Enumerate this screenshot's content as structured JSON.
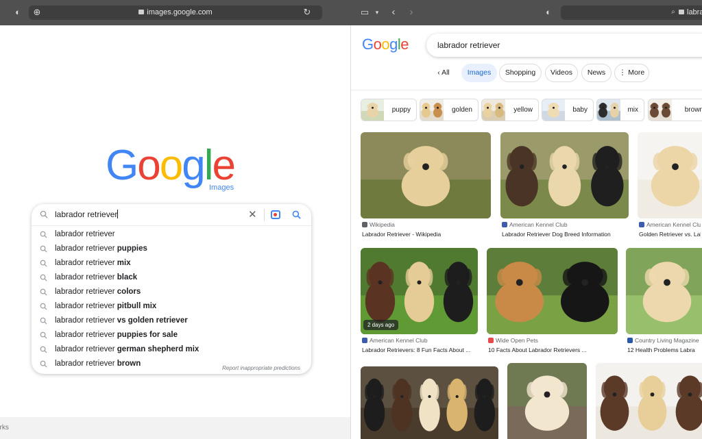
{
  "left_browser": {
    "url": "images.google.com"
  },
  "right_browser": {
    "url": "labrac"
  },
  "left_page": {
    "logo_letters": [
      {
        "ch": "G",
        "color": "#4285f4"
      },
      {
        "ch": "o",
        "color": "#ea4335"
      },
      {
        "ch": "o",
        "color": "#fbbc05"
      },
      {
        "ch": "g",
        "color": "#4285f4"
      },
      {
        "ch": "l",
        "color": "#34a853"
      },
      {
        "ch": "e",
        "color": "#ea4335"
      }
    ],
    "logo_sub": "Images",
    "search_query": "labrador retriever",
    "suggestions": [
      {
        "base": "labrador retriever",
        "bold": ""
      },
      {
        "base": "labrador retriever",
        "bold": "puppies"
      },
      {
        "base": "labrador retriever",
        "bold": "mix"
      },
      {
        "base": "labrador retriever",
        "bold": "black"
      },
      {
        "base": "labrador retriever",
        "bold": "colors"
      },
      {
        "base": "labrador retriever",
        "bold": "pitbull mix"
      },
      {
        "base": "labrador retriever",
        "bold": "vs golden retriever"
      },
      {
        "base": "labrador retriever",
        "bold": "puppies for sale"
      },
      {
        "base": "labrador retriever",
        "bold": "german shepherd mix"
      },
      {
        "base": "labrador retriever",
        "bold": "brown"
      }
    ],
    "report_link": "Report inappropriate predictions",
    "footer_text": "orks"
  },
  "right_page": {
    "logo_letters": [
      {
        "ch": "G",
        "color": "#4285f4"
      },
      {
        "ch": "o",
        "color": "#ea4335"
      },
      {
        "ch": "o",
        "color": "#fbbc05"
      },
      {
        "ch": "g",
        "color": "#4285f4"
      },
      {
        "ch": "l",
        "color": "#34a853"
      },
      {
        "ch": "e",
        "color": "#ea4335"
      }
    ],
    "search_query": "labrador retriever",
    "tabs": {
      "all": "All",
      "images": "Images",
      "shopping": "Shopping",
      "videos": "Videos",
      "news": "News",
      "more": "More"
    },
    "chips": [
      "puppy",
      "golden",
      "yellow",
      "baby",
      "mix",
      "brown"
    ],
    "results": [
      {
        "source": "Wikipedia",
        "title": "Labrador Retriever - Wikipedia",
        "fav": "#5f6368",
        "badge": ""
      },
      {
        "source": "American Kennel Club",
        "title": "Labrador Retriever Dog Breed Information",
        "fav": "#3c5ba8",
        "badge": ""
      },
      {
        "source": "American Kennel Clu",
        "title": "Golden Retriever vs. Lab",
        "fav": "#3c5ba8",
        "badge": ""
      },
      {
        "source": "American Kennel Club",
        "title": "Labrador Retrievers: 8 Fun Facts About ...",
        "fav": "#3c5ba8",
        "badge": "2 days ago"
      },
      {
        "source": "Wide Open Pets",
        "title": "10 Facts About Labrador Retrievers ...",
        "fav": "#e64a4a",
        "badge": ""
      },
      {
        "source": "Country Living Magazine",
        "title": "12 Health Problems Labra",
        "fav": "#2b57a8",
        "badge": ""
      }
    ]
  }
}
